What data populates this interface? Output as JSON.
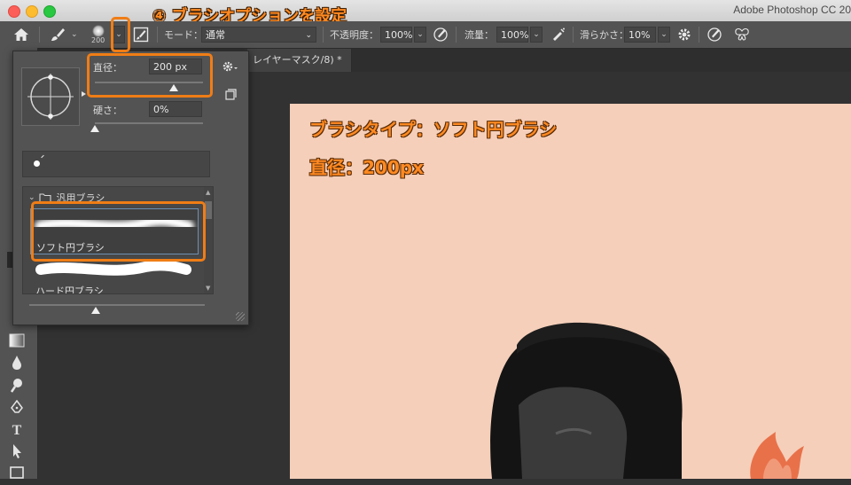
{
  "window": {
    "app_title": "Adobe Photoshop CC 20"
  },
  "caption": "④ ブラシオプションを設定",
  "options_bar": {
    "brush_size_value": "200",
    "mode_label": "モード：",
    "mode_value": "通常",
    "opacity_label": "不透明度：",
    "opacity_value": "100%",
    "flow_label": "流量：",
    "flow_value": "100%",
    "smoothing_label": "滑らかさ：",
    "smoothing_value": "10%"
  },
  "document_tab": {
    "title": "レイヤーマスク/8) *"
  },
  "brush_panel": {
    "size_label": "直径：",
    "size_value": "200 px",
    "size_slider_fraction": 0.73,
    "hardness_label": "硬さ：",
    "hardness_value": "0%",
    "hardness_slider_fraction": 0.0,
    "folder_label": "汎用ブラシ",
    "brushes": [
      {
        "name": "ソフト円ブラシ",
        "selected": true
      },
      {
        "name": "ハード円ブラシ",
        "selected": false
      }
    ]
  },
  "overlay": {
    "line1": "ブラシタイプ：ソフト円ブラシ",
    "line2": "直径：200px"
  },
  "colors": {
    "accent_orange": "#f07d16",
    "canvas_bg": "#f5cfba",
    "ui_dark": "#535353"
  }
}
